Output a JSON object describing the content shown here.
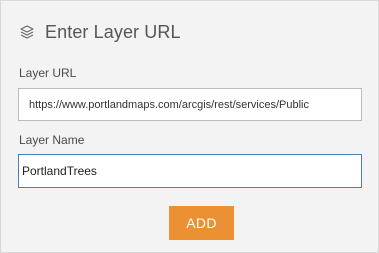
{
  "header": {
    "title": "Enter Layer URL",
    "icon": "layers-icon"
  },
  "form": {
    "url_label": "Layer URL",
    "url_value": "https://www.portlandmaps.com/arcgis/rest/services/Public",
    "name_label": "Layer Name",
    "name_value": "PortlandTrees",
    "add_label": "ADD"
  },
  "colors": {
    "accent_button": "#ec9133",
    "focus_border": "#4a7fb7",
    "panel_background": "#f3f3f3"
  }
}
